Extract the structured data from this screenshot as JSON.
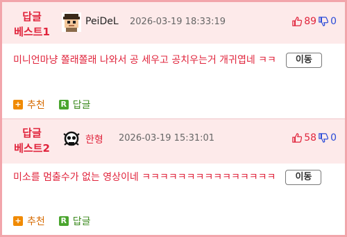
{
  "comments": [
    {
      "best_line1": "답글",
      "best_line2": "베스트1",
      "nickname": "PeiDeL",
      "timestamp": "2026-03-19 18:33:19",
      "upvotes": "89",
      "downvotes": "0",
      "text": "미니언마냥 쫄래쫄래 나와서 공 세우고 공치우는거 개귀엽네 ㅋㅋ",
      "move_label": "이동",
      "recommend_label": "추천",
      "reply_label": "답글"
    },
    {
      "best_line1": "답글",
      "best_line2": "베스트2",
      "nickname": "한형",
      "timestamp": "2026-03-19 15:31:01",
      "upvotes": "58",
      "downvotes": "0",
      "text": "미소를 멈출수가 없는 영상이네 ㅋㅋㅋㅋㅋㅋㅋㅋㅋㅋㅋㅋㅋㅋㅋ",
      "move_label": "이동",
      "recommend_label": "추천",
      "reply_label": "답글"
    }
  ],
  "colors": {
    "accent_red": "#e0233b",
    "header_bg": "#fdeaea",
    "border": "#f2a5ab",
    "downvote_blue": "#2a4bd8"
  },
  "icons": {
    "upvote": "thumbs-up-icon",
    "downvote": "thumbs-down-icon",
    "recommend": "plus-square-icon",
    "reply": "reply-r-icon"
  }
}
